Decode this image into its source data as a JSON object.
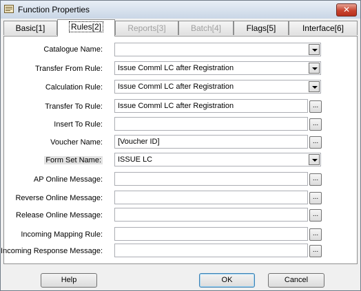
{
  "window": {
    "title": "Function Properties",
    "close_glyph": "✕"
  },
  "tabs": [
    {
      "label": "Basic[1]",
      "state": "normal"
    },
    {
      "label": "Rules[2]",
      "state": "active"
    },
    {
      "label": "Reports[3]",
      "state": "disabled"
    },
    {
      "label": "Batch[4]",
      "state": "disabled"
    },
    {
      "label": "Flags[5]",
      "state": "normal"
    },
    {
      "label": "Interface[6]",
      "state": "normal"
    }
  ],
  "form": {
    "catalogue_name": {
      "label": "Catalogue Name:",
      "value": ""
    },
    "transfer_from_rule": {
      "label": "Transfer From Rule:",
      "value": "Issue Comml LC after Registration"
    },
    "calculation_rule": {
      "label": "Calculation Rule:",
      "value": "Issue Comml LC after Registration"
    },
    "transfer_to_rule": {
      "label": "Transfer To Rule:",
      "value": "Issue Comml LC after Registration"
    },
    "insert_to_rule": {
      "label": "Insert To Rule:",
      "value": ""
    },
    "voucher_name": {
      "label": "Voucher Name:",
      "value": "[Voucher ID]"
    },
    "form_set_name": {
      "label": "Form Set Name:",
      "value": "ISSUE LC"
    },
    "ap_online_message": {
      "label": "AP Online Message:",
      "value": ""
    },
    "reverse_online_message": {
      "label": "Reverse Online Message:",
      "value": ""
    },
    "release_online_message": {
      "label": "Release Online Message:",
      "value": ""
    },
    "incoming_mapping_rule": {
      "label": "Incoming Mapping Rule:",
      "value": ""
    },
    "incoming_response_message": {
      "label": "Incoming Response Message:",
      "value": ""
    },
    "ellipsis": "..."
  },
  "buttons": {
    "help": "Help",
    "ok": "OK",
    "cancel": "Cancel"
  },
  "colors": {
    "title_bar": "#c9d6e6",
    "close_button": "#c7442f",
    "dialog_bg": "#f0f0f0",
    "panel_bg": "#ffffff"
  }
}
